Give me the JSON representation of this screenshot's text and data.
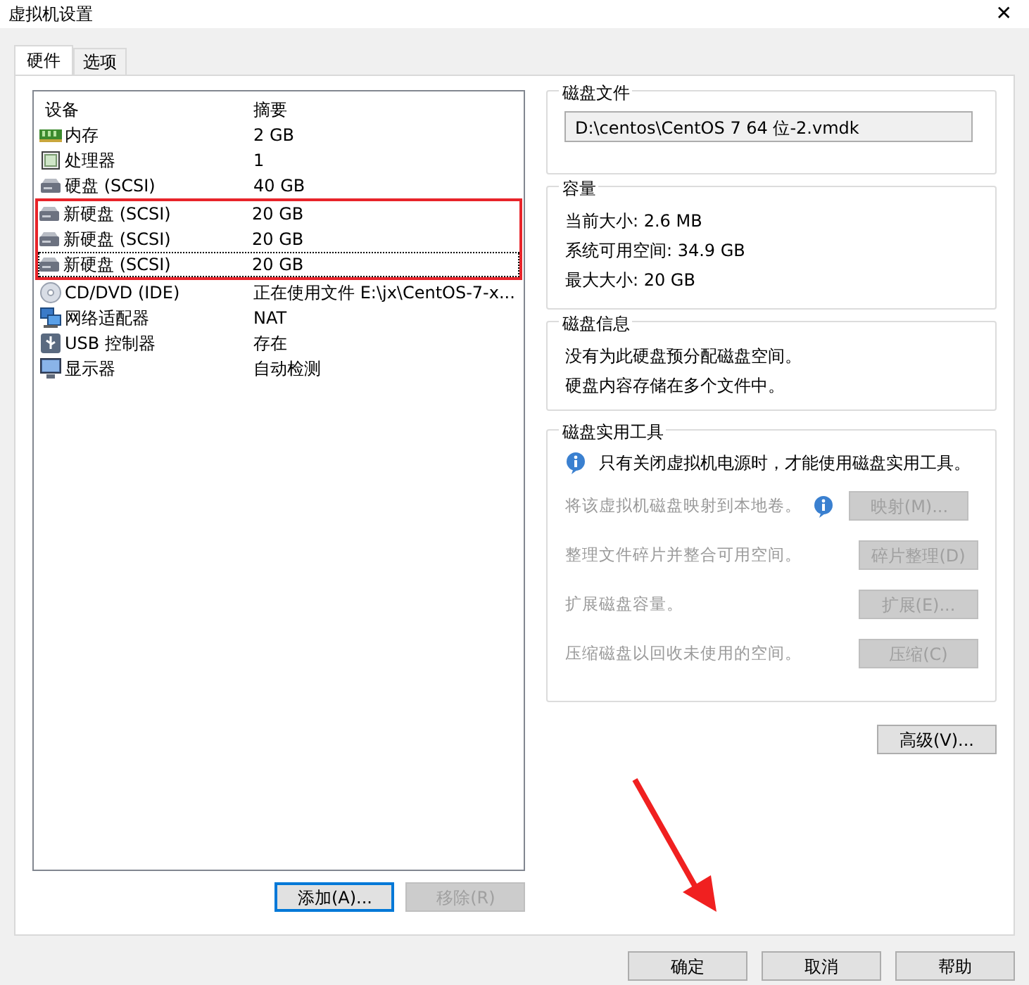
{
  "window": {
    "title": "虚拟机设置",
    "close": "✕"
  },
  "tabs": [
    {
      "label": "硬件",
      "selected": true
    },
    {
      "label": "选项",
      "selected": false
    }
  ],
  "device_list": {
    "columns": [
      "设备",
      "摘要"
    ],
    "rows": [
      {
        "kind": "memory",
        "device": "内存",
        "summary": "2 GB",
        "selected": false,
        "highlighted": false
      },
      {
        "kind": "processor",
        "device": "处理器",
        "summary": "1",
        "selected": false,
        "highlighted": false
      },
      {
        "kind": "disk",
        "device": "硬盘 (SCSI)",
        "summary": "40 GB",
        "selected": false,
        "highlighted": false
      },
      {
        "kind": "disk",
        "device": "新硬盘 (SCSI)",
        "summary": "20 GB",
        "selected": false,
        "highlighted": true
      },
      {
        "kind": "disk",
        "device": "新硬盘 (SCSI)",
        "summary": "20 GB",
        "selected": false,
        "highlighted": true
      },
      {
        "kind": "disk",
        "device": "新硬盘 (SCSI)",
        "summary": "20 GB",
        "selected": true,
        "highlighted": true
      },
      {
        "kind": "cd",
        "device": "CD/DVD (IDE)",
        "summary": "正在使用文件 E:\\jx\\CentOS-7-x...",
        "selected": false,
        "highlighted": false
      },
      {
        "kind": "network",
        "device": "网络适配器",
        "summary": "NAT",
        "selected": false,
        "highlighted": false
      },
      {
        "kind": "usb",
        "device": "USB 控制器",
        "summary": "存在",
        "selected": false,
        "highlighted": false
      },
      {
        "kind": "display",
        "device": "显示器",
        "summary": "自动检测",
        "selected": false,
        "highlighted": false
      }
    ],
    "buttons": [
      {
        "label": "添加(A)...",
        "disabled": false
      },
      {
        "label": "移除(R)",
        "disabled": true
      }
    ]
  },
  "disk_file": {
    "title": "磁盘文件",
    "value": "D:\\centos\\CentOS 7 64 位-2.vmdk"
  },
  "capacity": {
    "title": "容量",
    "lines": [
      "当前大小: 2.6 MB",
      "系统可用空间: 34.9 GB",
      "最大大小: 20 GB"
    ]
  },
  "disk_info": {
    "title": "磁盘信息",
    "lines": [
      "没有为此硬盘预分配磁盘空间。",
      "硬盘内容存储在多个文件中。"
    ]
  },
  "disk_utilities": {
    "title": "磁盘实用工具",
    "notice": "只有关闭虚拟机电源时，才能使用磁盘实用工具。",
    "tools": [
      {
        "text": "将该虚拟机磁盘映射到本地卷。",
        "button": "映射(M)...",
        "disabled": true,
        "info": true
      },
      {
        "text": "整理文件碎片并整合可用空间。",
        "button": "碎片整理(D)",
        "disabled": true,
        "info": false
      },
      {
        "text": "扩展磁盘容量。",
        "button": "扩展(E)...",
        "disabled": true,
        "info": false
      },
      {
        "text": "压缩磁盘以回收未使用的空间。",
        "button": "压缩(C)",
        "disabled": true,
        "info": false
      }
    ]
  },
  "advanced_button": "高级(V)...",
  "annotation_arrow": true,
  "dialog_buttons": [
    "确定",
    "取消",
    "帮助"
  ]
}
